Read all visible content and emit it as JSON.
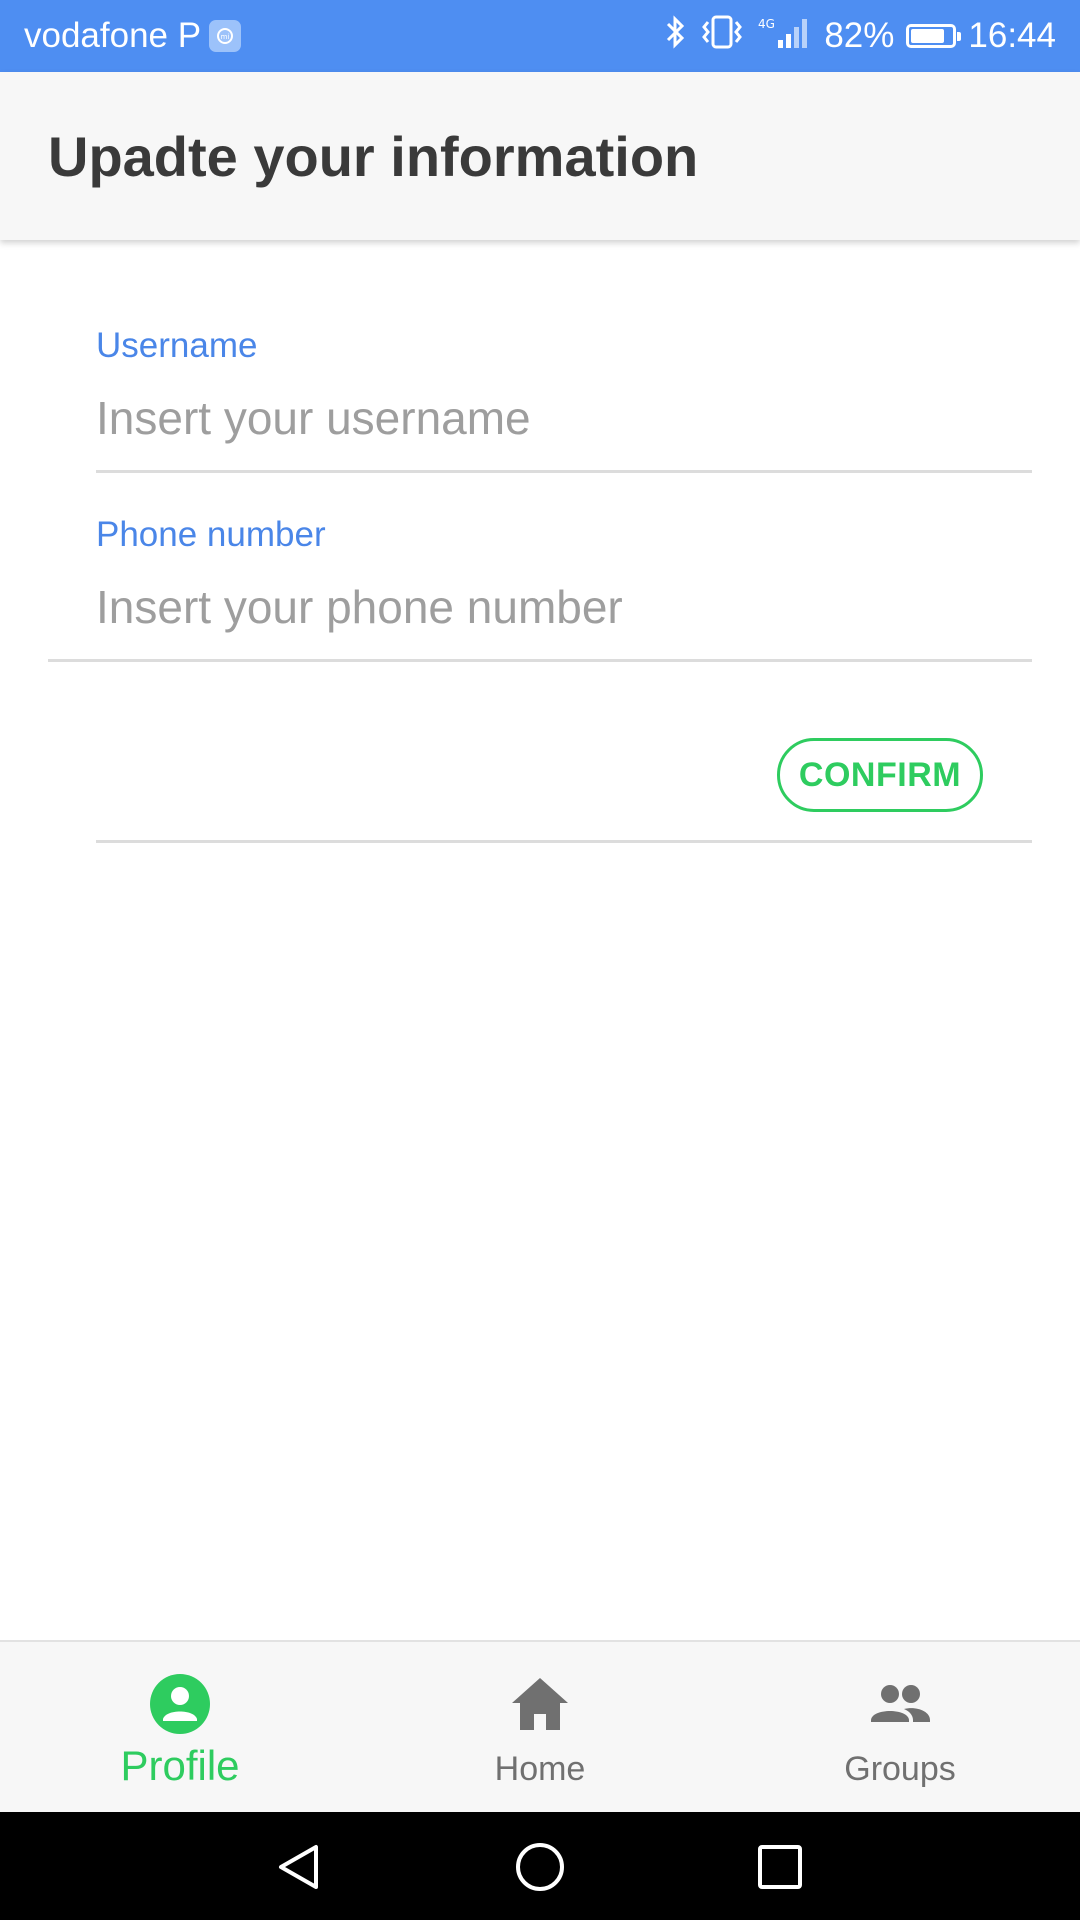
{
  "status_bar": {
    "carrier": "vodafone P",
    "network": "4G",
    "battery": "82%",
    "battery_level": 0.82,
    "time": "16:44",
    "icons": [
      "mi-icon",
      "bluetooth-icon",
      "vibrate-icon",
      "signal-icon",
      "battery-icon"
    ]
  },
  "header": {
    "title": "Upadte your information"
  },
  "form": {
    "username": {
      "label": "Username",
      "placeholder": "Insert your username",
      "value": ""
    },
    "phone": {
      "label": "Phone number",
      "placeholder": "Insert your phone number",
      "value": ""
    },
    "confirm_label": "CONFIRM"
  },
  "bottom_nav": {
    "items": [
      {
        "label": "Profile",
        "icon": "account-circle-icon",
        "active": true
      },
      {
        "label": "Home",
        "icon": "home-icon",
        "active": false
      },
      {
        "label": "Groups",
        "icon": "groups-icon",
        "active": false
      }
    ]
  },
  "system_nav": {
    "icons": [
      "back-icon",
      "home-circle-icon",
      "recents-icon"
    ]
  },
  "colors": {
    "status_bar": "#4e8ef2",
    "label_blue": "#4a86e8",
    "accent_green": "#2ecc5f",
    "header_bg": "#f7f7f7",
    "inactive_icon": "#707070"
  }
}
